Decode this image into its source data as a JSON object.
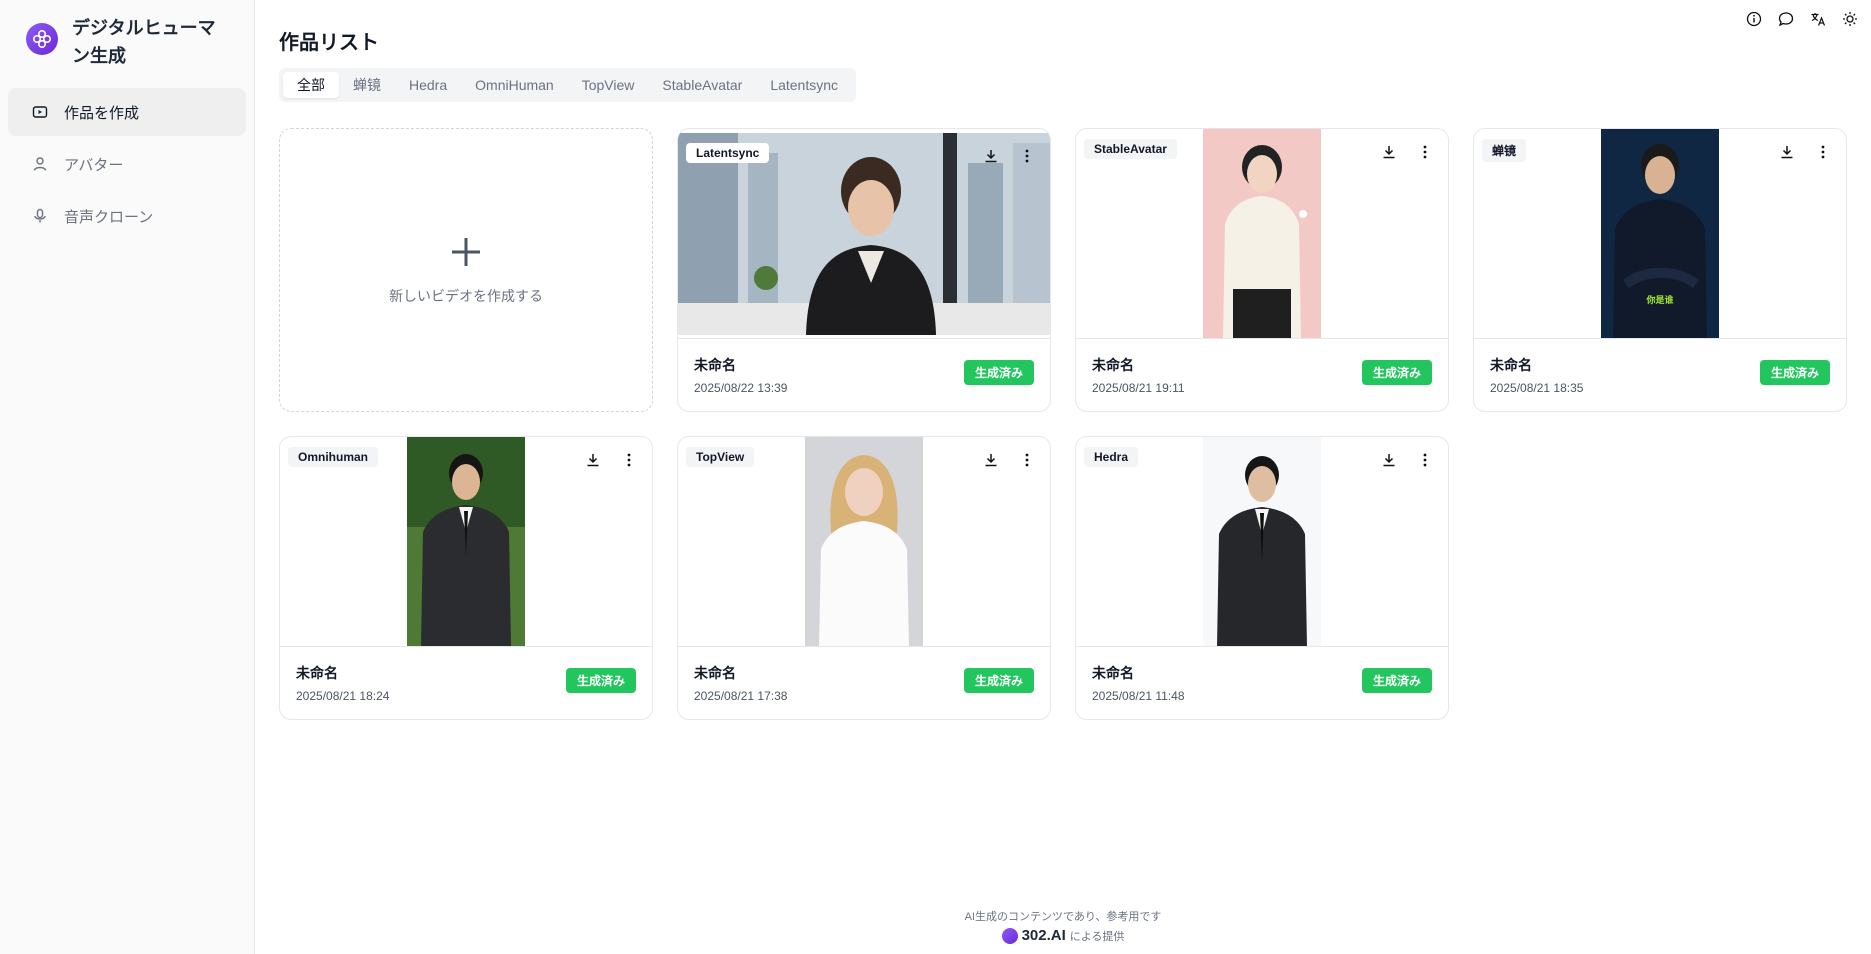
{
  "app": {
    "title": "デジタルヒューマン生成"
  },
  "sidebar": {
    "items": [
      {
        "label": "作品を作成",
        "icon": "video-icon"
      },
      {
        "label": "アバター",
        "icon": "user-icon"
      },
      {
        "label": "音声クローン",
        "icon": "mic-icon"
      }
    ]
  },
  "topbar": {
    "icons": [
      "info-icon",
      "chat-icon",
      "translate-icon",
      "theme-icon"
    ]
  },
  "main": {
    "title": "作品リスト",
    "tabs": [
      "全部",
      "蝉镜",
      "Hedra",
      "OmniHuman",
      "TopView",
      "StableAvatar",
      "Latentsync"
    ],
    "active_tab": "全部",
    "new_card": {
      "label": "新しいビデオを作成する"
    },
    "cards": [
      {
        "badge": "Latentsync",
        "name": "未命名",
        "date": "2025/08/22 13:39",
        "status": "生成済み"
      },
      {
        "badge": "StableAvatar",
        "name": "未命名",
        "date": "2025/08/21 19:11",
        "status": "生成済み"
      },
      {
        "badge": "蝉镜",
        "name": "未命名",
        "date": "2025/08/21 18:35",
        "status": "生成済み",
        "overlay_text": "你是谁"
      },
      {
        "badge": "Omnihuman",
        "name": "未命名",
        "date": "2025/08/21 18:24",
        "status": "生成済み"
      },
      {
        "badge": "TopView",
        "name": "未命名",
        "date": "2025/08/21 17:38",
        "status": "生成済み"
      },
      {
        "badge": "Hedra",
        "name": "未命名",
        "date": "2025/08/21 11:48",
        "status": "生成済み"
      }
    ]
  },
  "footer": {
    "line1": "AI生成のコンテンツであり、参考用です",
    "brand": "302.AI",
    "line2": "による提供"
  },
  "colors": {
    "accent": "#7c3aed",
    "status": "#22c55e"
  }
}
